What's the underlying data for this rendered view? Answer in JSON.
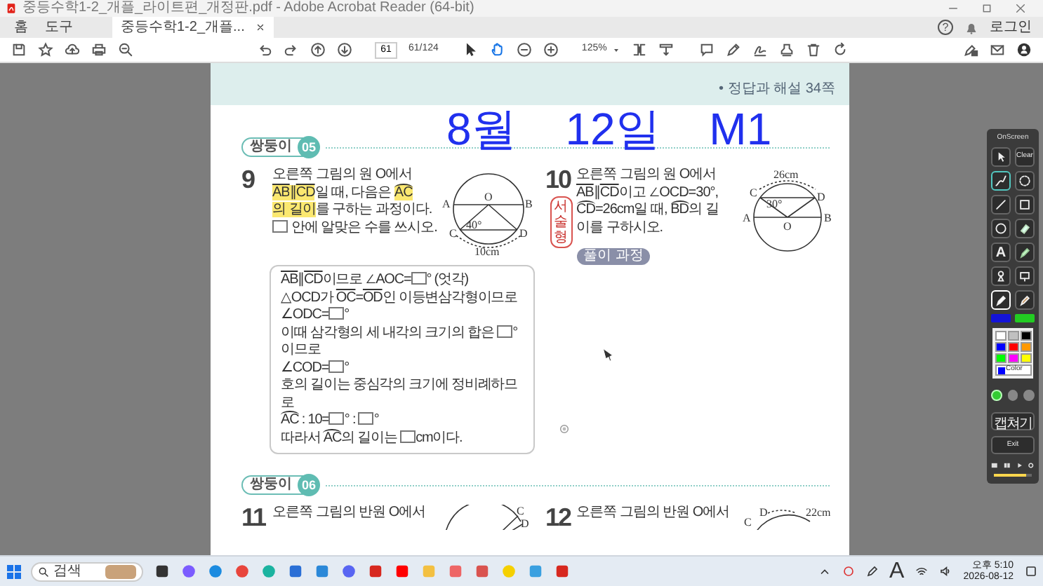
{
  "window": {
    "title": "중등수학1-2_개플_라이트편_개정판.pdf - Adobe Acrobat Reader (64-bit)"
  },
  "menu": [
    {
      "label": "홈",
      "selected": false
    },
    {
      "label": "도구",
      "selected": false
    }
  ],
  "doc_tab": {
    "label": "중등수학1-2_개플...",
    "selected": true
  },
  "help": "?",
  "login": "로그인",
  "toolbar": {
    "page": "61",
    "page_count": "61/124",
    "zoom": "125%",
    "hand_tool_selected": true
  },
  "page": {
    "note": "• 정답과 해설 34쪽",
    "handwriting": "8월 12일 M1",
    "sections": [
      {
        "tag": "쌍둥이",
        "number": "05",
        "problems": [
          {
            "number": "9",
            "statement": [
              [
                {
                  "text": "오른쪽 그림의 원 O에서"
                }
              ],
              [
                {
                  "text": "AB",
                  "kind": "seg",
                  "hl": true
                },
                {
                  "text": "∥",
                  "hl": true
                },
                {
                  "text": "CD",
                  "kind": "seg",
                  "hl": true
                },
                {
                  "text": "일 때, 다음은 "
                },
                {
                  "text": "AC",
                  "kind": "arc",
                  "hl": true
                }
              ],
              [
                {
                  "text": "의 길이",
                  "hl": true
                },
                {
                  "text": "를 구하는 과정이다."
                }
              ],
              [
                {
                  "kind": "box"
                },
                {
                  "text": " 안에 알맞은 수를 쓰시오."
                }
              ]
            ],
            "figure": {
              "kind": "circle_chords",
              "labels": [
                "A",
                "B",
                "C",
                "D",
                "O",
                "40°",
                "10cm"
              ]
            },
            "solution": [
              [
                {
                  "text": "AB",
                  "kind": "seg"
                },
                {
                  "text": "∥"
                },
                {
                  "text": "CD",
                  "kind": "seg"
                },
                {
                  "text": "이므로 ∠AOC="
                },
                {
                  "kind": "box"
                },
                {
                  "text": "° (엇각)"
                }
              ],
              [
                {
                  "text": "△OCD가 "
                },
                {
                  "text": "OC",
                  "kind": "seg"
                },
                {
                  "text": "="
                },
                {
                  "text": "OD",
                  "kind": "seg"
                },
                {
                  "text": "인 이등변삼각형이므로"
                }
              ],
              [
                {
                  "text": "∠ODC="
                },
                {
                  "kind": "box"
                },
                {
                  "text": "°"
                }
              ],
              [
                {
                  "text": "이때 삼각형의 세 내각의 크기의 합은 "
                },
                {
                  "kind": "box"
                },
                {
                  "text": "°이므로"
                }
              ],
              [
                {
                  "text": "∠COD="
                },
                {
                  "kind": "box"
                },
                {
                  "text": "°"
                }
              ],
              [
                {
                  "text": "호의 길이는 중심각의 크기에 정비례하므로"
                }
              ],
              [
                {
                  "text": "AC",
                  "kind": "arc"
                },
                {
                  "text": " : 10="
                },
                {
                  "kind": "box"
                },
                {
                  "text": "° : "
                },
                {
                  "kind": "box"
                },
                {
                  "text": "°"
                }
              ],
              [
                {
                  "text": "따라서 "
                },
                {
                  "text": "AC",
                  "kind": "arc"
                },
                {
                  "text": "의 길이는 "
                },
                {
                  "kind": "box"
                },
                {
                  "text": "cm이다."
                }
              ]
            ]
          },
          {
            "number": "10",
            "side_badge": "서술형",
            "statement": [
              [
                {
                  "text": "오른쪽 그림의 원 O에서"
                }
              ],
              [
                {
                  "text": "AB",
                  "kind": "seg"
                },
                {
                  "text": "∥"
                },
                {
                  "text": "CD",
                  "kind": "seg"
                },
                {
                  "text": "이고 ∠OCD=30°,"
                }
              ],
              [
                {
                  "text": "CD",
                  "kind": "arc"
                },
                {
                  "text": "=26cm일 때, "
                },
                {
                  "text": "BD",
                  "kind": "arc"
                },
                {
                  "text": "의 길"
                }
              ],
              [
                {
                  "text": "이를 구하시오."
                }
              ]
            ],
            "tag": "풀이 과정",
            "figure": {
              "kind": "circle_top_chord",
              "labels": [
                "26cm",
                "C",
                "30°",
                "D",
                "A",
                "O",
                "B"
              ]
            }
          }
        ]
      },
      {
        "tag": "쌍둥이",
        "number": "06",
        "problems": [
          {
            "number": "11",
            "statement": [
              [
                {
                  "text": "오른쪽 그림의 반원 O에서"
                }
              ]
            ],
            "figure": {
              "kind": "semicircle_right",
              "labels": [
                "C",
                "D"
              ]
            }
          },
          {
            "number": "12",
            "statement": [
              [
                {
                  "text": "오른쪽 그림의 반원 O에서"
                }
              ]
            ],
            "figure": {
              "kind": "semicircle_left",
              "labels": [
                "D",
                "22cm",
                "C"
              ]
            }
          }
        ]
      }
    ]
  },
  "onscreen": {
    "title": "OnScreen",
    "tools": [
      {
        "kind": "pointer",
        "selected": false
      },
      {
        "kind": "clear",
        "label": "Clear",
        "selected": false
      },
      {
        "kind": "freehand",
        "selected": true
      },
      {
        "kind": "lasso",
        "selected": false
      },
      {
        "kind": "line",
        "selected": false
      },
      {
        "kind": "rect",
        "selected": false
      },
      {
        "kind": "ellipse",
        "selected": false
      },
      {
        "kind": "eraser",
        "selected": false
      },
      {
        "kind": "text",
        "label": "A",
        "selected": false
      },
      {
        "kind": "highlighter",
        "selected": false
      },
      {
        "kind": "stamp",
        "selected": false
      },
      {
        "kind": "board",
        "selected": false
      },
      {
        "kind": "pen",
        "selected": true
      },
      {
        "kind": "brush",
        "selected": false
      }
    ],
    "pen_colors": [
      {
        "color": "#1414d8"
      },
      {
        "color": "#22cc22"
      }
    ],
    "palette": [
      {
        "color": "#ffffff"
      },
      {
        "color": "#c0c0c0"
      },
      {
        "color": "#000000"
      },
      {
        "color": "#0000ff"
      },
      {
        "color": "#ff0000"
      },
      {
        "color": "#ff9900"
      },
      {
        "color": "#00ff00"
      },
      {
        "color": "#ff00ff"
      },
      {
        "color": "#ffff00"
      }
    ],
    "color_button": {
      "label": "Color",
      "color": "#0000ff"
    },
    "modes": [
      {
        "selected": true
      },
      {
        "selected": false
      },
      {
        "selected": false
      }
    ],
    "capture": "캡쳐기",
    "exit": "Exit",
    "size": {
      "level": 0.85
    }
  },
  "taskbar": {
    "search_placeholder": "검색",
    "time": "오후 5:10",
    "date": "2026-08-12",
    "ime": "A"
  }
}
